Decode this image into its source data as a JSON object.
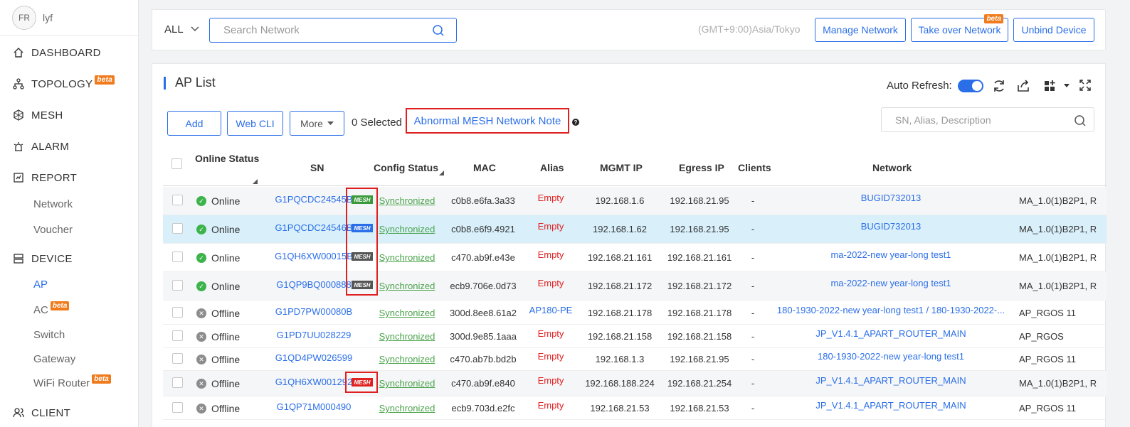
{
  "user": {
    "avatar_text": "FR",
    "name": "lyf"
  },
  "nav": {
    "dashboard": "DASHBOARD",
    "topology": "TOPOLOGY",
    "mesh": "MESH",
    "alarm": "ALARM",
    "report": "REPORT",
    "report_network": "Network",
    "report_voucher": "Voucher",
    "device": "DEVICE",
    "device_ap": "AP",
    "device_ac": "AC",
    "device_switch": "Switch",
    "device_gateway": "Gateway",
    "device_wifi_router": "WiFi Router",
    "client": "CLIENT",
    "beta": "beta"
  },
  "topbar": {
    "scope": "ALL",
    "search_placeholder": "Search Network",
    "timezone": "(GMT+9:00)Asia/Tokyo",
    "manage_network": "Manage Network",
    "take_over_network": "Take over Network",
    "unbind_device": "Unbind Device",
    "beta": "beta"
  },
  "panel": {
    "title": "AP List",
    "auto_refresh_label": "Auto Refresh:",
    "auto_refresh_on": true,
    "add": "Add",
    "web_cli": "Web CLI",
    "more": "More",
    "selected": "0 Selected",
    "abnormal_note": "Abnormal MESH Network Note",
    "help_glyph": "?",
    "search_placeholder": "SN, Alias, Description"
  },
  "columns": {
    "online_status": "Online Status",
    "sn": "SN",
    "config_status": "Config Status",
    "mac": "MAC",
    "alias": "Alias",
    "mgmt_ip": "MGMT IP",
    "egress_ip": "Egress IP",
    "clients": "Clients",
    "network": "Network"
  },
  "mesh_badge_text": "MESH",
  "colors": {
    "accent": "#2a6ee8",
    "online": "#3cb44b",
    "offline": "#8c8c8c",
    "empty": "#e02020",
    "sync": "#4aa34a",
    "highlight_box": "#e02020",
    "mesh_green": "#3a9a3a",
    "mesh_blue": "#2a6ee8",
    "mesh_gray": "#555555",
    "mesh_red": "#e02020"
  },
  "rows": [
    {
      "status": "Online",
      "sn": "G1PQCDC24545B",
      "mesh": "green",
      "config": "Synchronized",
      "mac": "c0b8.e6fa.3a33",
      "alias": "Empty",
      "mgmt_ip": "192.168.1.6",
      "egress_ip": "192.168.21.95",
      "clients": "-",
      "network": "BUGID732013",
      "firmware": "MA_1.0(1)B2P1, R"
    },
    {
      "status": "Online",
      "sn": "G1PQCDC24546B",
      "mesh": "blue",
      "config": "Synchronized",
      "mac": "c0b8.e6f9.4921",
      "alias": "Empty",
      "mgmt_ip": "192.168.1.62",
      "egress_ip": "192.168.21.95",
      "clients": "-",
      "network": "BUGID732013",
      "firmware": "MA_1.0(1)B2P1, R"
    },
    {
      "status": "Online",
      "sn": "G1QH6XW00015B",
      "mesh": "gray",
      "config": "Synchronized",
      "mac": "c470.ab9f.e43e",
      "alias": "Empty",
      "mgmt_ip": "192.168.21.161",
      "egress_ip": "192.168.21.161",
      "clients": "-",
      "network": "ma-2022-new year-long test1",
      "firmware": "MA_1.0(1)B2P1, R"
    },
    {
      "status": "Online",
      "sn": "G1QP9BQ000888",
      "mesh": "gray",
      "config": "Synchronized",
      "mac": "ecb9.706e.0d73",
      "alias": "Empty",
      "mgmt_ip": "192.168.21.172",
      "egress_ip": "192.168.21.172",
      "clients": "-",
      "network": "ma-2022-new year-long test1",
      "firmware": "MA_1.0(1)B2P1, R"
    },
    {
      "status": "Offline",
      "sn": "G1PD7PW00080B",
      "mesh": "",
      "config": "Synchronized",
      "mac": "300d.8ee8.61a2",
      "alias": "AP180-PE",
      "mgmt_ip": "192.168.21.178",
      "egress_ip": "192.168.21.178",
      "clients": "-",
      "network": "180-1930-2022-new year-long test1 / 180-1930-2022-...",
      "firmware": "AP_RGOS 11"
    },
    {
      "status": "Offline",
      "sn": "G1PD7UU028229",
      "mesh": "",
      "config": "Synchronized",
      "mac": "300d.9e85.1aaa",
      "alias": "Empty",
      "mgmt_ip": "192.168.21.158",
      "egress_ip": "192.168.21.158",
      "clients": "-",
      "network": "JP_V1.4.1_APART_ROUTER_MAIN",
      "firmware": "AP_RGOS"
    },
    {
      "status": "Offline",
      "sn": "G1QD4PW026599",
      "mesh": "",
      "config": "Synchronized",
      "mac": "c470.ab7b.bd2b",
      "alias": "Empty",
      "mgmt_ip": "192.168.1.3",
      "egress_ip": "192.168.21.95",
      "clients": "-",
      "network": "180-1930-2022-new year-long test1",
      "firmware": "AP_RGOS 11"
    },
    {
      "status": "Offline",
      "sn": "G1QH6XW001292",
      "mesh": "red",
      "config": "Synchronized",
      "mac": "c470.ab9f.e840",
      "alias": "Empty",
      "mgmt_ip": "192.168.188.224",
      "egress_ip": "192.168.21.254",
      "clients": "-",
      "network": "JP_V1.4.1_APART_ROUTER_MAIN",
      "firmware": "MA_1.0(1)B2P1, R"
    },
    {
      "status": "Offline",
      "sn": "G1QP71M000490",
      "mesh": "",
      "config": "Synchronized",
      "mac": "ecb9.703d.e2fc",
      "alias": "Empty",
      "mgmt_ip": "192.168.21.53",
      "egress_ip": "192.168.21.53",
      "clients": "-",
      "network": "JP_V1.4.1_APART_ROUTER_MAIN",
      "firmware": "AP_RGOS 11"
    }
  ]
}
